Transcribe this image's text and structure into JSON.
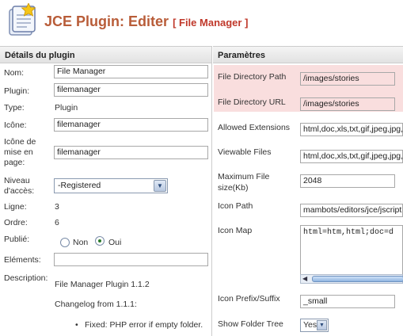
{
  "header": {
    "title": "JCE Plugin:",
    "subtitle": "Editer",
    "bracket_text": "[ File Manager ]"
  },
  "left": {
    "heading": "Détails du plugin",
    "name_label": "Nom:",
    "name_value": "File Manager",
    "plugin_label": "Plugin:",
    "plugin_value": "filemanager",
    "type_label": "Type:",
    "type_value": "Plugin",
    "icon_label": "Icône:",
    "icon_value": "filemanager",
    "layout_icon_label_1": "Icône de",
    "layout_icon_label_2": "mise en",
    "layout_icon_label_3": "page:",
    "layout_icon_value": "filemanager",
    "access_label_1": "Niveau",
    "access_label_2": "d'accès:",
    "access_value": "-Registered",
    "line_label": "Ligne:",
    "line_value": "3",
    "order_label": "Ordre:",
    "order_value": "6",
    "published_label": "Publié:",
    "published_no": "Non",
    "published_yes": "Oui",
    "elements_label": "Eléments:",
    "elements_value": "",
    "description_label": "Description:",
    "desc_line1": "File Manager Plugin 1.1.2",
    "desc_line2": "Changelog from 1.1.1:",
    "desc_bullet": "Fixed: PHP error if empty folder."
  },
  "right": {
    "heading": "Paramètres",
    "dir_path_label": "File Directory Path",
    "dir_path_value": "/images/stories",
    "dir_url_label": "File Directory URL",
    "dir_url_value": "/images/stories",
    "allowed_ext_label": "Allowed Extensions",
    "allowed_ext_value": "html,doc,xls,txt,gif,jpeg,jpg,p",
    "viewable_label": "Viewable Files",
    "viewable_value": "html,doc,xls,txt,gif,jpeg,jpg,p",
    "max_size_label_1": "Maximum File",
    "max_size_label_2": "size(Kb)",
    "max_size_value": "2048",
    "icon_path_label": "Icon Path",
    "icon_path_value": "mambots/editors/jce/jscript",
    "icon_map_label": "Icon Map",
    "icon_map_value": "html=htm,html;doc=d",
    "icon_prefix_label": "Icon Prefix/Suffix",
    "icon_prefix_value": "_small",
    "show_tree_label": "Show Folder Tree",
    "show_tree_value": "Yes"
  }
}
